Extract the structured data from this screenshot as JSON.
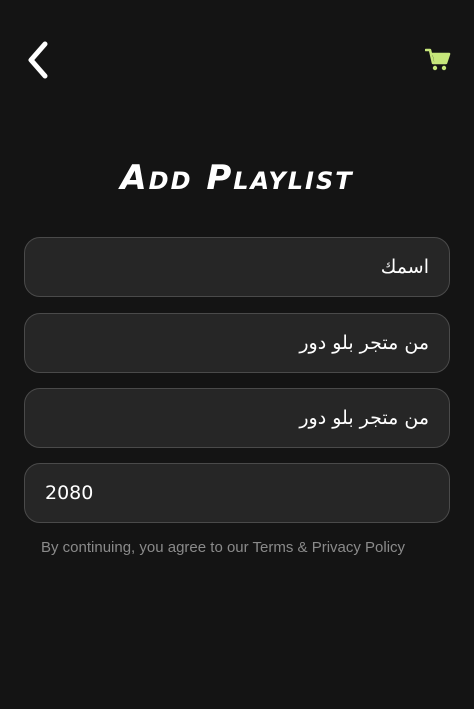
{
  "header": {
    "back_icon": "chevron-left-icon",
    "cart_icon": "shopping-cart-icon",
    "cart_color": "#c6e67a"
  },
  "title": "Add Playlist",
  "form": {
    "name_value": "اسمك",
    "url1_value": "من متجر بلو دور",
    "url2_value": "من متجر بلو دور",
    "port_value": "2080"
  },
  "terms": {
    "prefix": "By continuing, you agree to our ",
    "link": "Terms & Privacy Policy"
  },
  "colors": {
    "background": "#141414",
    "field_background": "#262626",
    "field_border": "#4a4a4a",
    "text": "#ffffff",
    "muted": "#8a8a8a"
  }
}
